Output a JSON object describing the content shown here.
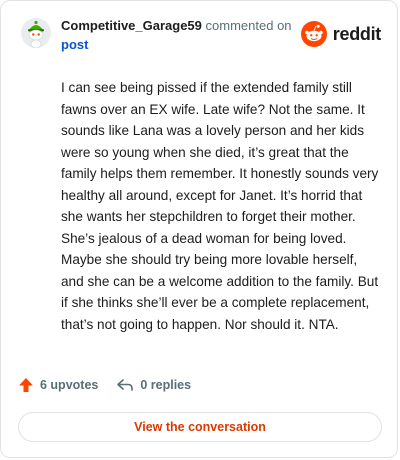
{
  "header": {
    "username": "Competitive_Garage59",
    "action_text": "commented on",
    "target_text": "post"
  },
  "logo": {
    "wordmark": "reddit",
    "brand_color": "#ff4500"
  },
  "comment": {
    "text": "I can see being pissed if the extended family still fawns over an EX wife. Late wife? Not the same. It sounds like Lana was a lovely person and her kids were so young when she died, it’s great that the family helps them remember. It honestly sounds very healthy all around, except for Janet. It’s horrid that she wants her stepchildren to forget their mother. She’s jealous of a dead woman for being loved. Maybe she should try being more lovable herself, and she can be a welcome addition to the family. But if she thinks she’ll ever be a complete replacement, that’s not going to happen. Nor should it. NTA."
  },
  "actions": {
    "upvotes_label": "6 upvotes",
    "replies_label": "0 replies",
    "upvote_icon": "upvote-arrow-icon",
    "reply_icon": "reply-arrow-icon"
  },
  "footer": {
    "button_label": "View the conversation",
    "accent_color": "#d93a00"
  }
}
